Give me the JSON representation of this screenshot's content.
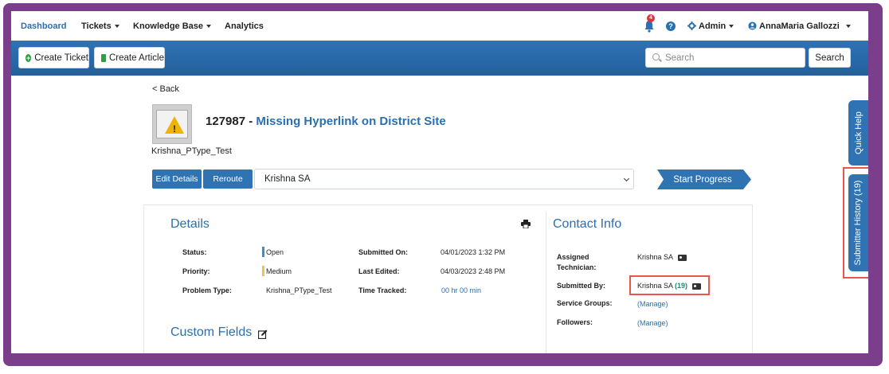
{
  "nav": {
    "dashboard": "Dashboard",
    "tickets": "Tickets",
    "knowledge_base": "Knowledge Base",
    "analytics": "Analytics",
    "notification_count": "4",
    "help": "?",
    "admin": "Admin",
    "user_name": "AnnaMaria Gallozzi"
  },
  "toolbar": {
    "create_ticket": "Create Ticket",
    "create_article": "Create Article",
    "search_placeholder": "Search",
    "search_button": "Search"
  },
  "ticket": {
    "back": "< Back",
    "number": "127987 - ",
    "subject": "Missing Hyperlink on District Site",
    "requester": "Krishna_PType_Test",
    "edit_details": "Edit Details",
    "reroute": "Reroute",
    "assignee_selected": "Krishna SA",
    "start_progress": "Start Progress"
  },
  "details": {
    "title": "Details",
    "status_label": "Status:",
    "status_value": "Open",
    "status_color": "#3a8fd1",
    "priority_label": "Priority:",
    "priority_value": "Medium",
    "priority_color": "#f2c14e",
    "problem_type_label": "Problem Type:",
    "problem_type_value": "Krishna_PType_Test",
    "submitted_on_label": "Submitted On:",
    "submitted_on_value": "04/01/2023 1:32 PM",
    "last_edited_label": "Last Edited:",
    "last_edited_value": "04/03/2023 2:48 PM",
    "time_tracked_label": "Time Tracked:",
    "time_tracked_value": "00 hr 00 min",
    "custom_fields_title": "Custom Fields"
  },
  "contact": {
    "title": "Contact Info",
    "assigned_tech_label_1": "Assigned",
    "assigned_tech_label_2": "Technician:",
    "assigned_tech_value": "Krishna SA",
    "submitted_by_label": "Submitted By:",
    "submitted_by_value": "Krishna SA",
    "submitted_by_count": "(19)",
    "service_groups_label": "Service Groups:",
    "service_groups_value": "(Manage)",
    "followers_label": "Followers:",
    "followers_value": "(Manage)"
  },
  "side_tabs": {
    "quick_help": "Quick Help",
    "submitter_history": "Submitter History (19)"
  },
  "colors": {
    "frame": "#7a3e8a",
    "brand_blue": "#2f73b3",
    "highlight": "#e9564e"
  }
}
